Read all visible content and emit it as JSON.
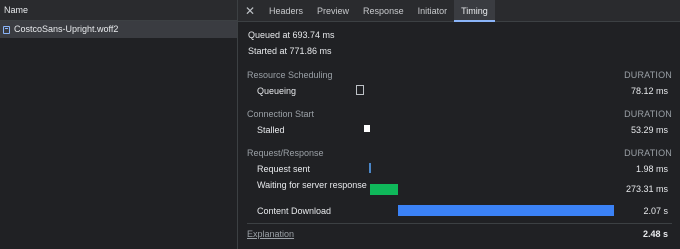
{
  "left": {
    "header": "Name",
    "requests": [
      {
        "name": "CostcoSans-Upright.woff2",
        "icon": "file-icon"
      }
    ]
  },
  "tabs": {
    "close_icon": "close-icon",
    "items": [
      "Headers",
      "Preview",
      "Response",
      "Initiator",
      "Timing"
    ],
    "active": "Timing"
  },
  "timing": {
    "queued_at": "Queued at 693.74 ms",
    "started_at": "Started at 771.86 ms",
    "duration_label": "DURATION",
    "sections": [
      {
        "title": "Resource Scheduling",
        "rows": [
          {
            "label": "Queueing",
            "value": "78.12 ms"
          }
        ]
      },
      {
        "title": "Connection Start",
        "rows": [
          {
            "label": "Stalled",
            "value": "53.29 ms"
          }
        ]
      },
      {
        "title": "Request/Response",
        "rows": [
          {
            "label": "Request sent",
            "value": "1.98 ms"
          },
          {
            "label": "Waiting for server response",
            "value": "273.31 ms"
          },
          {
            "label": "Content Download",
            "value": "2.07 s"
          }
        ]
      }
    ],
    "explanation": "Explanation",
    "total": "2.48 s",
    "colors": {
      "queueing": "#bdc1c6",
      "stalled": "#ffffff",
      "request_sent": "#4a86c8",
      "waiting": "#0fb85a",
      "download": "#3b82f6"
    }
  }
}
